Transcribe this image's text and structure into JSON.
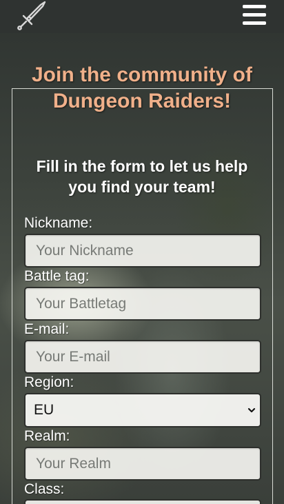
{
  "header": {
    "logo_icon": "sword-icon",
    "menu_icon": "hamburger-menu-icon"
  },
  "hero": {
    "title": "Join the community of Dungeon Raiders!",
    "subtitle": "Fill in the form to let us help you find your team!"
  },
  "form": {
    "nickname": {
      "label": "Nickname:",
      "placeholder": "Your Nickname",
      "value": ""
    },
    "battletag": {
      "label": "Battle tag:",
      "placeholder": "Your Battletag",
      "value": ""
    },
    "email": {
      "label": "E-mail:",
      "placeholder": "Your E-mail",
      "value": ""
    },
    "region": {
      "label": "Region:",
      "selected": "EU"
    },
    "realm": {
      "label": "Realm:",
      "placeholder": "Your Realm",
      "value": ""
    },
    "class": {
      "label": "Class:"
    }
  },
  "colors": {
    "title": "#f0b08a",
    "text": "#ffffff",
    "header_bg": "#2f3331",
    "input_bg": "#f8f8f4"
  }
}
